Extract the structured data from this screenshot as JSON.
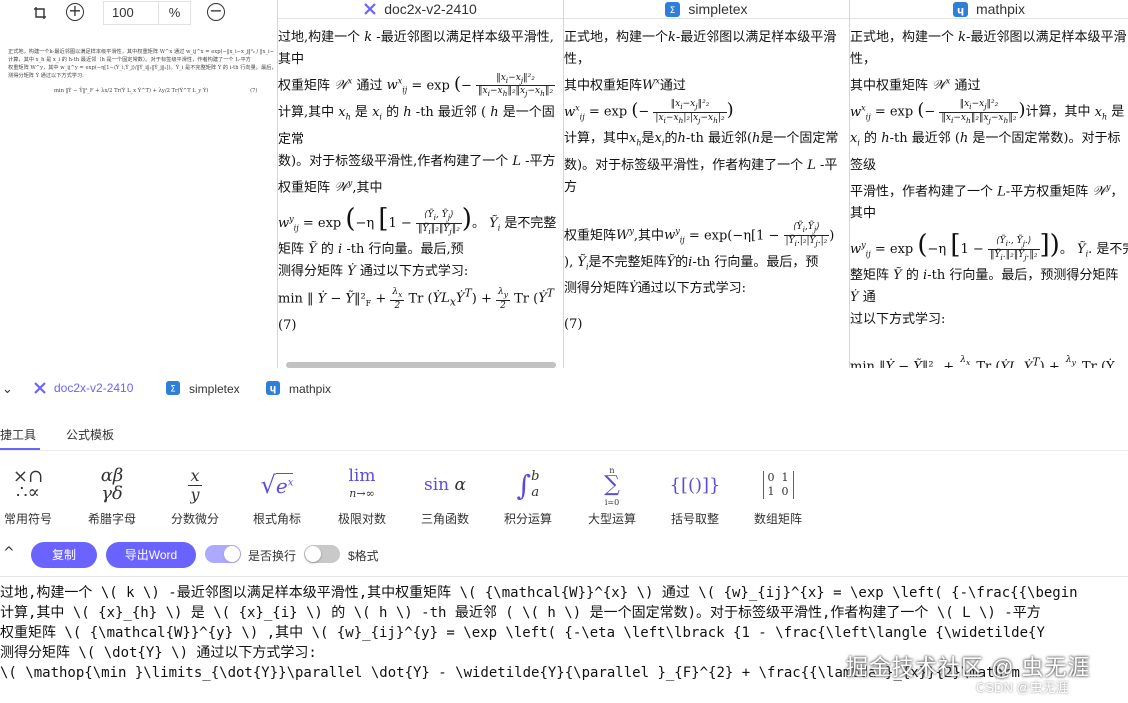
{
  "preview": {
    "zoom_value": "100",
    "zoom_unit": "%",
    "text_line1": "正式地，构建一个k-最近邻图以满足样本级平滑性，其中权重矩阵 W^x 通过 w_ij^x = exp(−‖x_i−x_j‖²₂ / ‖x_i−x_h‖₂‖x_j−x_h‖₂)",
    "text_line2": "计算，其中 x_h 是 x_i 的 h-th 最近邻（h 是一个固定常数）。对于标签级平滑性，作者构建了一个 L-平方",
    "text_line3": "权重矩阵 W^y，其中 w_ij^y = exp(−η[1−⟨Ỹ_i,Ỹ_j⟩/‖Ỹ_i‖₂‖Ỹ_j‖₂])。Ỹ_i 是不完整矩阵 Ỹ 的 i-th 行向量。最后，预",
    "text_line4": "测得分矩阵 Ẏ 通过以下方式学习:",
    "equation": "min ‖Ẏ − Ỹ‖²_F + λx/2 Tr(Ẏ L_x Ẏ^T) + λy/2 Tr(Ẏ^T L_y Ẏ)",
    "eq_tag": "(7)"
  },
  "results": {
    "tabs": [
      {
        "label": "doc2x-v2-2410"
      },
      {
        "label": "simpletex"
      },
      {
        "label": "mathpix"
      }
    ],
    "doc2x": {
      "p1a": "过地,构建一个",
      "p1b": "-最近邻图以满足样本级平滑性,其中",
      "p2a": "权重矩阵",
      "p2b": "通过",
      "p3a": "计算,其中",
      "p3b": "是",
      "p3c": "的",
      "p3d": "-th 最近邻 (",
      "p3e": "是一个固定常",
      "p4": "数)。对于标签级平滑性,作者构建了一个",
      "p4b": "-平方",
      "p5a": "权重矩阵",
      "p5b": ",其中",
      "p6a": "。",
      "p6b": "是不完整",
      "p7a": "矩阵",
      "p7b": "的",
      "p7c": "-th 行向量。最后,预",
      "p8a": "测得分矩阵",
      "p8b": "通过以下方式学习:",
      "tag": "(7)"
    },
    "simpletex": {
      "p1a": "正式地，构建一个",
      "p1b": "-最近邻图以满足样本级平滑性，",
      "p2a": "其中权重矩阵",
      "p2b": "通过",
      "p3a": "计算，其中",
      "p3b": "是",
      "p3c": "的",
      "p3d": "-th 最近邻(",
      "p3e": "是一个固定常",
      "p4a": "数)。对于标签级平滑性，作者构建了一个",
      "p4b": "-平方",
      "p5a": "权重矩阵",
      "p5b": ",其中",
      "p6a": "),",
      "p6b": "是不完整矩阵",
      "p6c": "的",
      "p6d": "-th 行向量。最后，预",
      "p7": "测得分矩阵",
      "p7b": "通过以下方式学习:",
      "tag": "(7)"
    },
    "mathpix": {
      "p1a": "正式地，构建一个",
      "p1b": "-最近邻图以满足样本级平滑性，",
      "p2a": "其中权重矩阵",
      "p2b": "通过",
      "p3a": "计算，其中",
      "p3b": "是",
      "p4a": "的",
      "p4b": "-th 最近邻 (",
      "p4c": "是一个固定常数)。对于标签级",
      "p5a": "平滑性，作者构建了一个",
      "p5b": "-平方权重矩阵",
      "p5c": "，其中",
      "p6a": "。",
      "p6b": "是不完",
      "p7a": "整矩阵",
      "p7b": "的",
      "p7c": "-th 行向量。最后，预测得分矩阵",
      "p7d": "通",
      "p8": "过以下方式学习:"
    }
  },
  "lower_tabs": [
    {
      "label": "doc2x-v2-2410"
    },
    {
      "label": "simpletex"
    },
    {
      "label": "mathpix"
    }
  ],
  "tool_tabs": [
    {
      "label": "快捷工具"
    },
    {
      "label": "公式模板"
    }
  ],
  "palette": [
    {
      "label": "常用符号",
      "icon": "common-symbols-icon"
    },
    {
      "label": "希腊字母",
      "icon": "greek-letters-icon"
    },
    {
      "label": "分数微分",
      "icon": "fraction-icon"
    },
    {
      "label": "根式角标",
      "icon": "radical-icon"
    },
    {
      "label": "极限对数",
      "icon": "limit-icon"
    },
    {
      "label": "三角函数",
      "icon": "trig-icon"
    },
    {
      "label": "积分运算",
      "icon": "integral-icon"
    },
    {
      "label": "大型运算",
      "icon": "sum-icon"
    },
    {
      "label": "括号取整",
      "icon": "bracket-icon"
    },
    {
      "label": "数组矩阵",
      "icon": "matrix-icon"
    }
  ],
  "actions": {
    "copy_label": "复制",
    "export_label": "导出Word",
    "wrap_label": "是否换行",
    "dollar_label": "$格式",
    "wrap_on": true,
    "dollar_on": false
  },
  "editor": {
    "line1": "过地,构建一个 \\( k \\) -最近邻图以满足样本级平滑性,其中权重矩阵 \\( {\\mathcal{W}}^{x} \\) 通过 \\( {w}_{ij}^{x} = \\exp \\left( {-\\frac{{\\begin",
    "line2": "计算,其中 \\( {x}_{h} \\) 是 \\( {x}_{i} \\) 的 \\( h \\) -th 最近邻 ( \\( h \\) 是一个固定常数)。对于标签级平滑性,作者构建了一个 \\( L \\) -平方",
    "line3": "权重矩阵 \\( {\\mathcal{W}}^{y} \\) ,其中 \\( {w}_{ij}^{y} = \\exp \\left( {-\\eta \\left\\lbrack  {1 - \\frac{\\left\\langle  {\\widetilde{Y",
    "line4": "测得分矩阵 \\( \\dot{Y} \\) 通过以下方式学习:",
    "line5": "\\( \\mathop{\\min }\\limits_{\\dot{Y}}\\parallel \\dot{Y} - \\widetilde{Y}{\\parallel }_{F}^{2} + \\frac{{\\lambda }_{x}}{2}\\mathrm"
  },
  "watermark": {
    "text": "掘金技术社区 @ 虫无涯",
    "small": "CSDN @虫无涯"
  },
  "colors": {
    "accent": "#6b63ff",
    "palette_glyph": "#5c4dd9",
    "code_keyword": "#0a6d8e",
    "code_brace": "#1a7f20"
  }
}
